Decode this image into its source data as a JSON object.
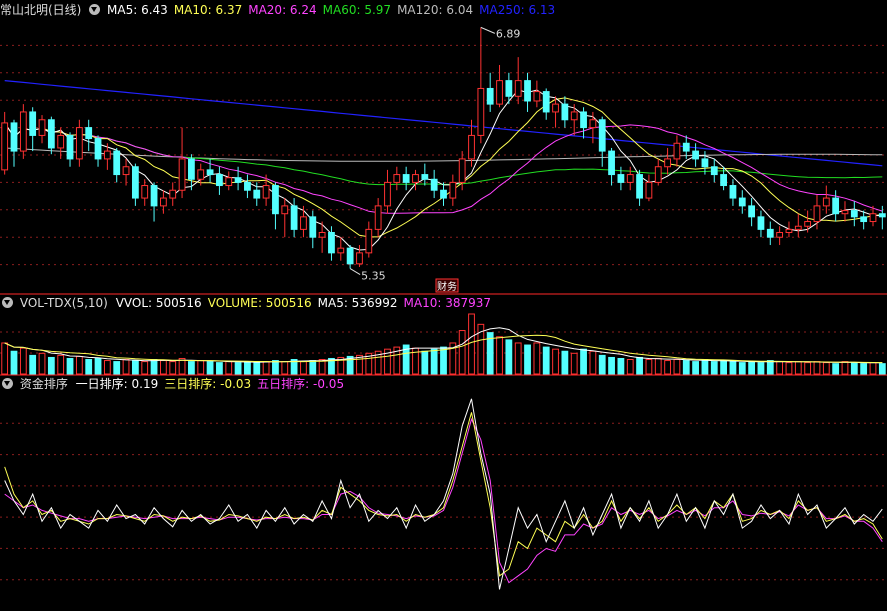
{
  "colors": {
    "up": "#ff3232",
    "down": "#54ffff",
    "ma5": "#ffffff",
    "ma10": "#ffff55",
    "ma20": "#ff44ff",
    "ma60": "#22dd22",
    "ma120": "#bbbbbb",
    "ma250": "#2222ff",
    "panel_border": "#ff2828",
    "grid": "#8b1e1e"
  },
  "icons": {
    "panel_menu": "dropdown-triangle-icon"
  },
  "price_panel": {
    "title": "常山北明(日线)",
    "indicators": [
      {
        "label": "MA5: 6.43",
        "color": "#ffffff"
      },
      {
        "label": "MA10: 6.37",
        "color": "#ffff55"
      },
      {
        "label": "MA20: 6.24",
        "color": "#ff44ff"
      },
      {
        "label": "MA60: 5.97",
        "color": "#22dd22"
      },
      {
        "label": "MA120: 6.04",
        "color": "#bbbbbb"
      },
      {
        "label": "MA250: 6.13",
        "color": "#2222ff"
      }
    ],
    "high_label": "6.89",
    "low_label": "5.35",
    "tag_label": "财务"
  },
  "volume_panel": {
    "title": "VOL-TDX(5,10)",
    "indicators": [
      {
        "label": "VVOL: 500516",
        "color": "#ffffff"
      },
      {
        "label": "VOLUME: 500516",
        "color": "#ffff55"
      },
      {
        "label": "MA5: 536992",
        "color": "#ffffff"
      },
      {
        "label": "MA10: 387937",
        "color": "#ff44ff"
      }
    ]
  },
  "rank_panel": {
    "title": "资金排序",
    "indicators": [
      {
        "label": "一日排序: 0.19",
        "color": "#ffffff"
      },
      {
        "label": "三日排序: -0.03",
        "color": "#ffff55"
      },
      {
        "label": "五日排序: -0.05",
        "color": "#ff44ff"
      }
    ]
  },
  "chart_data": {
    "type": "candlestick",
    "price_range": [
      5.2,
      6.95
    ],
    "ohlc": [
      [
        5.98,
        6.28,
        6.35,
        5.95
      ],
      [
        6.28,
        6.1,
        6.3,
        6.0
      ],
      [
        6.1,
        6.35,
        6.4,
        6.05
      ],
      [
        6.35,
        6.2,
        6.38,
        6.1
      ],
      [
        6.2,
        6.3,
        6.33,
        6.15
      ],
      [
        6.3,
        6.12,
        6.32,
        6.08
      ],
      [
        6.12,
        6.2,
        6.25,
        6.05
      ],
      [
        6.2,
        6.05,
        6.22,
        6.0
      ],
      [
        6.05,
        6.25,
        6.3,
        6.0
      ],
      [
        6.25,
        6.18,
        6.3,
        6.1
      ],
      [
        6.18,
        6.05,
        6.2,
        6.0
      ],
      [
        6.05,
        6.1,
        6.15,
        5.98
      ],
      [
        6.1,
        5.95,
        6.12,
        5.9
      ],
      [
        5.95,
        6.0,
        6.05,
        5.88
      ],
      [
        6.0,
        5.8,
        6.02,
        5.75
      ],
      [
        5.8,
        5.88,
        5.92,
        5.75
      ],
      [
        5.88,
        5.75,
        5.9,
        5.65
      ],
      [
        5.75,
        5.8,
        5.85,
        5.7
      ],
      [
        5.8,
        5.85,
        5.9,
        5.75
      ],
      [
        5.85,
        6.05,
        6.25,
        5.8
      ],
      [
        6.05,
        5.92,
        6.08,
        5.85
      ],
      [
        5.92,
        5.98,
        6.02,
        5.88
      ],
      [
        5.98,
        5.95,
        6.05,
        5.9
      ],
      [
        5.95,
        5.88,
        6.0,
        5.82
      ],
      [
        5.88,
        5.93,
        5.97,
        5.85
      ],
      [
        5.93,
        5.9,
        6.0,
        5.85
      ],
      [
        5.9,
        5.85,
        5.95,
        5.8
      ],
      [
        5.85,
        5.8,
        5.9,
        5.75
      ],
      [
        5.8,
        5.88,
        5.95,
        5.75
      ],
      [
        5.88,
        5.7,
        5.9,
        5.6
      ],
      [
        5.7,
        5.75,
        5.8,
        5.55
      ],
      [
        5.75,
        5.6,
        5.8,
        5.55
      ],
      [
        5.6,
        5.68,
        5.75,
        5.55
      ],
      [
        5.68,
        5.55,
        5.72,
        5.48
      ],
      [
        5.55,
        5.58,
        5.65,
        5.45
      ],
      [
        5.58,
        5.45,
        5.62,
        5.4
      ],
      [
        5.45,
        5.48,
        5.55,
        5.4
      ],
      [
        5.48,
        5.38,
        5.5,
        5.35
      ],
      [
        5.38,
        5.45,
        5.5,
        5.36
      ],
      [
        5.45,
        5.6,
        5.65,
        5.42
      ],
      [
        5.6,
        5.75,
        5.8,
        5.55
      ],
      [
        5.75,
        5.9,
        5.98,
        5.7
      ],
      [
        5.9,
        5.95,
        6.0,
        5.85
      ],
      [
        5.95,
        5.9,
        6.0,
        5.85
      ],
      [
        5.9,
        5.95,
        5.98,
        5.85
      ],
      [
        5.95,
        5.92,
        6.02,
        5.88
      ],
      [
        5.92,
        5.85,
        5.98,
        5.8
      ],
      [
        5.85,
        5.8,
        5.9,
        5.75
      ],
      [
        5.8,
        5.9,
        5.95,
        5.75
      ],
      [
        5.9,
        6.05,
        6.1,
        5.85
      ],
      [
        6.05,
        6.2,
        6.3,
        6.0
      ],
      [
        6.2,
        6.5,
        6.89,
        6.15
      ],
      [
        6.5,
        6.4,
        6.6,
        6.35
      ],
      [
        6.4,
        6.55,
        6.65,
        6.38
      ],
      [
        6.55,
        6.45,
        6.6,
        6.4
      ],
      [
        6.45,
        6.55,
        6.7,
        6.4
      ],
      [
        6.55,
        6.42,
        6.6,
        6.35
      ],
      [
        6.42,
        6.48,
        6.55,
        6.38
      ],
      [
        6.48,
        6.35,
        6.5,
        6.3
      ],
      [
        6.35,
        6.4,
        6.45,
        6.25
      ],
      [
        6.4,
        6.3,
        6.45,
        6.25
      ],
      [
        6.3,
        6.35,
        6.4,
        6.2
      ],
      [
        6.35,
        6.25,
        6.38,
        6.18
      ],
      [
        6.25,
        6.3,
        6.35,
        6.15
      ],
      [
        6.3,
        6.1,
        6.32,
        6.0
      ],
      [
        6.1,
        5.95,
        6.12,
        5.88
      ],
      [
        5.95,
        5.9,
        6.0,
        5.85
      ],
      [
        5.9,
        5.95,
        6.0,
        5.85
      ],
      [
        5.95,
        5.8,
        5.98,
        5.75
      ],
      [
        5.8,
        5.9,
        5.95,
        5.78
      ],
      [
        5.9,
        6.0,
        6.05,
        5.88
      ],
      [
        6.0,
        6.05,
        6.12,
        5.95
      ],
      [
        6.05,
        6.15,
        6.2,
        6.0
      ],
      [
        6.15,
        6.1,
        6.2,
        6.05
      ],
      [
        6.1,
        6.05,
        6.15,
        6.0
      ],
      [
        6.05,
        6.0,
        6.1,
        5.95
      ],
      [
        6.0,
        5.95,
        6.05,
        5.9
      ],
      [
        5.95,
        5.88,
        6.0,
        5.85
      ],
      [
        5.88,
        5.8,
        5.92,
        5.75
      ],
      [
        5.8,
        5.75,
        5.85,
        5.7
      ],
      [
        5.75,
        5.68,
        5.8,
        5.62
      ],
      [
        5.68,
        5.6,
        5.72,
        5.55
      ],
      [
        5.6,
        5.55,
        5.65,
        5.5
      ],
      [
        5.55,
        5.58,
        5.62,
        5.5
      ],
      [
        5.58,
        5.6,
        5.65,
        5.55
      ],
      [
        5.6,
        5.62,
        5.7,
        5.55
      ],
      [
        5.62,
        5.65,
        5.72,
        5.58
      ],
      [
        5.65,
        5.75,
        5.82,
        5.6
      ],
      [
        5.75,
        5.8,
        5.88,
        5.7
      ],
      [
        5.8,
        5.7,
        5.85,
        5.65
      ],
      [
        5.7,
        5.72,
        5.78,
        5.65
      ],
      [
        5.72,
        5.68,
        5.78,
        5.62
      ],
      [
        5.68,
        5.65,
        5.72,
        5.6
      ],
      [
        5.65,
        5.7,
        5.75,
        5.62
      ],
      [
        5.7,
        5.68,
        5.75,
        5.6
      ]
    ],
    "volume": [
      30,
      22,
      25,
      18,
      20,
      16,
      18,
      15,
      17,
      14,
      15,
      13,
      12,
      14,
      13,
      12,
      14,
      13,
      12,
      15,
      12,
      13,
      12,
      11,
      12,
      11,
      12,
      11,
      12,
      13,
      12,
      14,
      12,
      13,
      14,
      15,
      16,
      17,
      18,
      20,
      22,
      24,
      26,
      28,
      25,
      22,
      24,
      26,
      30,
      42,
      58,
      48,
      40,
      36,
      33,
      30,
      28,
      30,
      26,
      24,
      22,
      20,
      24,
      22,
      18,
      16,
      15,
      14,
      16,
      14,
      15,
      13,
      14,
      13,
      12,
      14,
      12,
      13,
      12,
      11,
      12,
      11,
      13,
      12,
      11,
      12,
      11,
      12,
      11,
      10,
      12,
      11,
      10,
      11,
      10
    ],
    "rank_series": [
      {
        "name": "一日排序",
        "values": [
          0.4,
          0.25,
          0.15,
          0.3,
          0.1,
          0.2,
          0.05,
          0.15,
          0.1,
          0.05,
          0.18,
          0.1,
          0.22,
          0.12,
          0.15,
          0.08,
          0.2,
          0.12,
          0.06,
          0.18,
          0.1,
          0.15,
          0.08,
          0.12,
          0.22,
          0.1,
          0.15,
          0.05,
          0.18,
          0.1,
          0.2,
          0.08,
          0.15,
          0.1,
          0.25,
          0.12,
          0.4,
          0.2,
          0.3,
          0.1,
          0.18,
          0.12,
          0.2,
          0.05,
          0.22,
          0.1,
          0.15,
          0.25,
          0.45,
          0.8,
          1.0,
          0.6,
          0.3,
          -0.4,
          -0.1,
          0.2,
          0.05,
          0.15,
          -0.05,
          0.1,
          0.25,
          0.05,
          0.2,
          0.0,
          0.15,
          0.3,
          0.05,
          0.2,
          0.1,
          0.25,
          0.05,
          0.15,
          0.3,
          0.1,
          0.2,
          0.05,
          0.25,
          0.15,
          0.3,
          0.05,
          0.1,
          0.22,
          0.12,
          0.18,
          0.08,
          0.3,
          0.15,
          0.22,
          0.05,
          0.12,
          0.2,
          0.08,
          0.15,
          0.1,
          0.19
        ]
      },
      {
        "name": "三日排序",
        "values": [
          0.5,
          0.3,
          0.2,
          0.25,
          0.15,
          0.18,
          0.1,
          0.12,
          0.1,
          0.08,
          0.12,
          0.12,
          0.15,
          0.14,
          0.12,
          0.1,
          0.15,
          0.14,
          0.1,
          0.13,
          0.12,
          0.14,
          0.1,
          0.11,
          0.15,
          0.14,
          0.12,
          0.1,
          0.13,
          0.12,
          0.15,
          0.12,
          0.13,
          0.11,
          0.18,
          0.15,
          0.35,
          0.3,
          0.25,
          0.18,
          0.15,
          0.14,
          0.15,
          0.1,
          0.15,
          0.13,
          0.15,
          0.2,
          0.4,
          0.65,
          0.9,
          0.55,
          0.2,
          -0.3,
          -0.25,
          -0.05,
          -0.1,
          0.05,
          0.0,
          -0.05,
          0.1,
          0.05,
          0.15,
          0.05,
          0.1,
          0.25,
          0.1,
          0.2,
          0.12,
          0.2,
          0.1,
          0.15,
          0.22,
          0.15,
          0.2,
          0.12,
          0.25,
          0.2,
          0.3,
          0.1,
          0.12,
          0.18,
          0.15,
          0.18,
          0.12,
          0.25,
          0.18,
          0.2,
          0.1,
          0.12,
          0.15,
          0.1,
          0.12,
          0.08,
          -0.03
        ]
      },
      {
        "name": "五日排序",
        "values": [
          0.3,
          0.25,
          0.2,
          0.22,
          0.18,
          0.16,
          0.14,
          0.12,
          0.12,
          0.1,
          0.12,
          0.12,
          0.13,
          0.14,
          0.13,
          0.12,
          0.13,
          0.14,
          0.12,
          0.12,
          0.12,
          0.13,
          0.12,
          0.11,
          0.13,
          0.13,
          0.12,
          0.11,
          0.12,
          0.12,
          0.13,
          0.12,
          0.12,
          0.11,
          0.15,
          0.15,
          0.3,
          0.32,
          0.28,
          0.2,
          0.16,
          0.15,
          0.14,
          0.12,
          0.14,
          0.13,
          0.14,
          0.18,
          0.35,
          0.6,
          0.85,
          0.7,
          0.4,
          -0.2,
          -0.35,
          -0.3,
          -0.25,
          -0.15,
          -0.1,
          -0.12,
          0.0,
          0.0,
          0.08,
          0.05,
          0.08,
          0.2,
          0.15,
          0.18,
          0.15,
          0.18,
          0.12,
          0.14,
          0.18,
          0.15,
          0.18,
          0.14,
          0.2,
          0.2,
          0.25,
          0.15,
          0.14,
          0.16,
          0.15,
          0.17,
          0.14,
          0.22,
          0.18,
          0.2,
          0.12,
          0.12,
          0.14,
          0.1,
          0.1,
          0.05,
          -0.05
        ]
      }
    ]
  }
}
